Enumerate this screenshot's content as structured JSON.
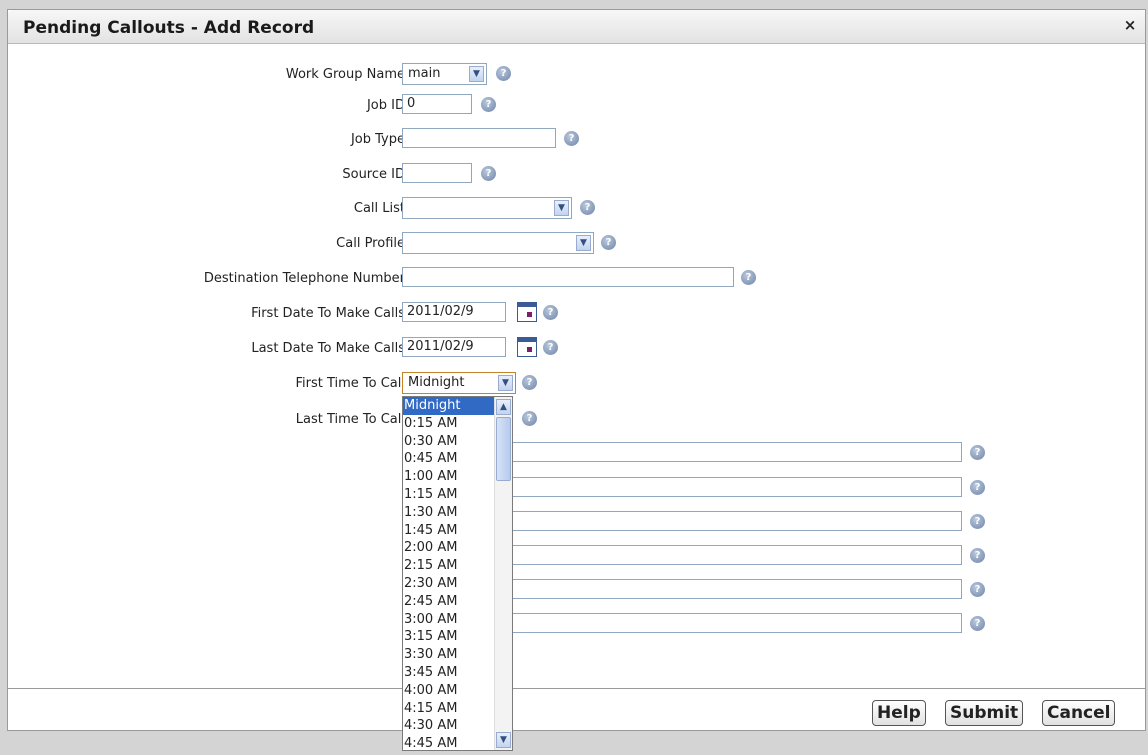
{
  "dialog": {
    "title": "Pending Callouts - Add Record",
    "close": "×"
  },
  "fields": {
    "work_group_name": {
      "label": "Work Group Name",
      "value": "main"
    },
    "job_id": {
      "label": "Job ID",
      "value": "0"
    },
    "job_type": {
      "label": "Job Type",
      "value": ""
    },
    "source_id": {
      "label": "Source ID",
      "value": ""
    },
    "call_list": {
      "label": "Call List",
      "value": ""
    },
    "call_profile": {
      "label": "Call Profile",
      "value": ""
    },
    "destination_phone": {
      "label": "Destination Telephone Number",
      "value": ""
    },
    "first_date": {
      "label": "First Date To Make Calls",
      "value": "2011/02/9"
    },
    "last_date": {
      "label": "Last Date To Make Calls",
      "value": "2011/02/9"
    },
    "first_time": {
      "label": "First Time To Call",
      "value": "Midnight"
    },
    "last_time": {
      "label": "Last Time To Call"
    }
  },
  "help_glyph": "?",
  "dropdown": {
    "options": [
      "Midnight",
      "0:15 AM",
      "0:30 AM",
      "0:45 AM",
      "1:00 AM",
      "1:15 AM",
      "1:30 AM",
      "1:45 AM",
      "2:00 AM",
      "2:15 AM",
      "2:30 AM",
      "2:45 AM",
      "3:00 AM",
      "3:15 AM",
      "3:30 AM",
      "3:45 AM",
      "4:00 AM",
      "4:15 AM",
      "4:30 AM",
      "4:45 AM"
    ],
    "selected_index": 0
  },
  "buttons": {
    "help": "Help",
    "submit": "Submit",
    "cancel": "Cancel"
  }
}
